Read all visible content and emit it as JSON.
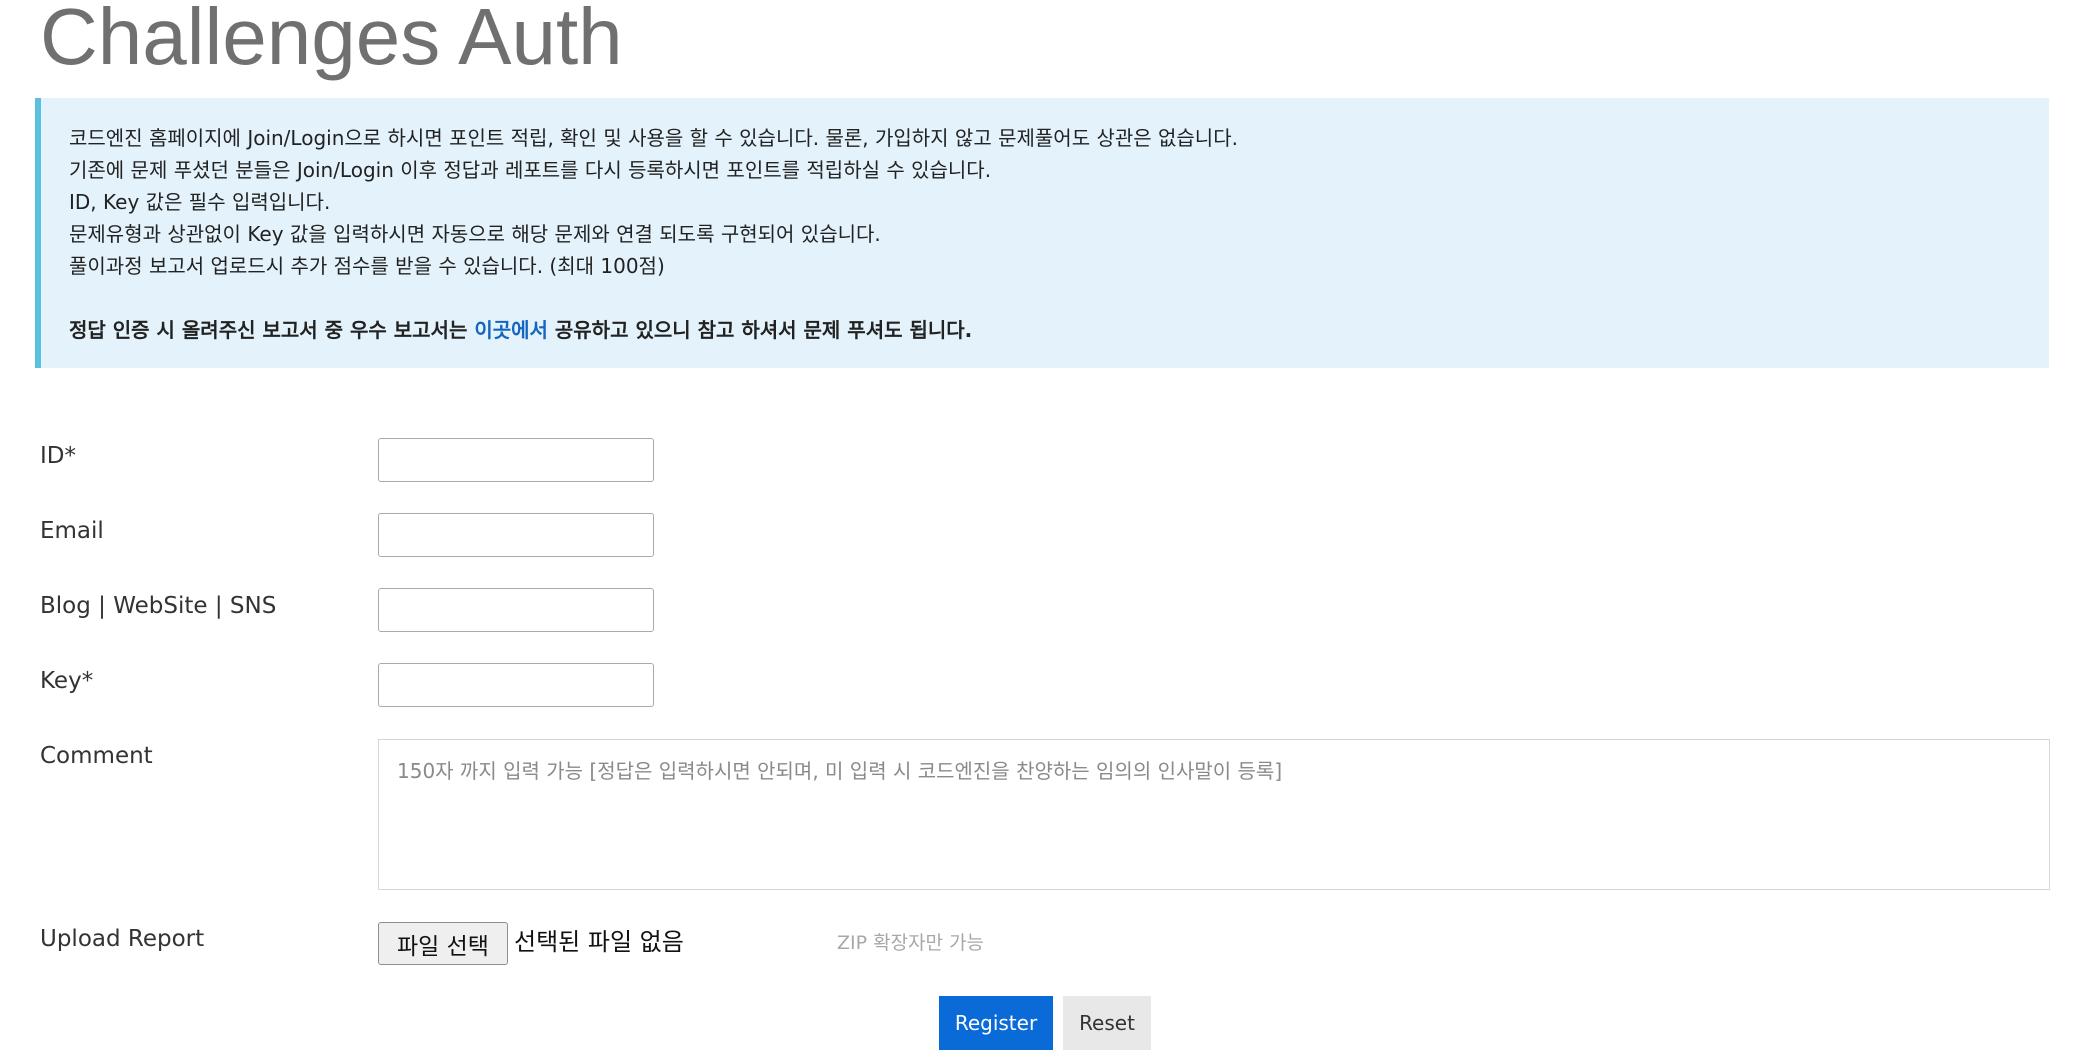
{
  "page": {
    "title": "Challenges Auth"
  },
  "notice": {
    "lines": [
      "코드엔진 홈페이지에 Join/Login으로 하시면 포인트 적립, 확인 및 사용을 할 수 있습니다. 물론, 가입하지 않고 문제풀어도 상관은 없습니다.",
      "기존에 문제 푸셨던 분들은 Join/Login 이후 정답과 레포트를 다시 등록하시면 포인트를 적립하실 수 있습니다.",
      "ID, Key 값은 필수 입력입니다.",
      "문제유형과 상관없이 Key 값을 입력하시면 자동으로 해당 문제와 연결 되도록 구현되어 있습니다.",
      "풀이과정 보고서 업로드시 추가 점수를 받을 수 있습니다. (최대 100점)"
    ],
    "highlight_before": "정답 인증 시 올려주신 보고서 중 우수 보고서는 ",
    "highlight_link": "이곳에서",
    "highlight_after": " 공유하고 있으니 참고 하셔서 문제 푸셔도 됩니다."
  },
  "form": {
    "id": {
      "label": "ID*",
      "value": ""
    },
    "email": {
      "label": "Email",
      "value": ""
    },
    "website": {
      "label": "Blog | WebSite | SNS",
      "value": ""
    },
    "key": {
      "label": "Key*",
      "value": ""
    },
    "comment": {
      "label": "Comment",
      "placeholder": "150자 까지 입력 가능 [정답은 입력하시면 안되며, 미 입력 시 코드엔진을 찬양하는 임의의 인사말이 등록]"
    },
    "upload": {
      "label": "Upload Report",
      "button_label": "파일 선택",
      "status": "선택된 파일 없음",
      "hint": "ZIP 확장자만 가능"
    }
  },
  "actions": {
    "register_label": "Register",
    "reset_label": "Reset"
  },
  "colors": {
    "notice_background": "#e4f3fb",
    "notice_border": "#5bc0de",
    "link": "#1565c0",
    "primary_button": "#0a6ad8",
    "secondary_button": "#e8e8e8"
  }
}
